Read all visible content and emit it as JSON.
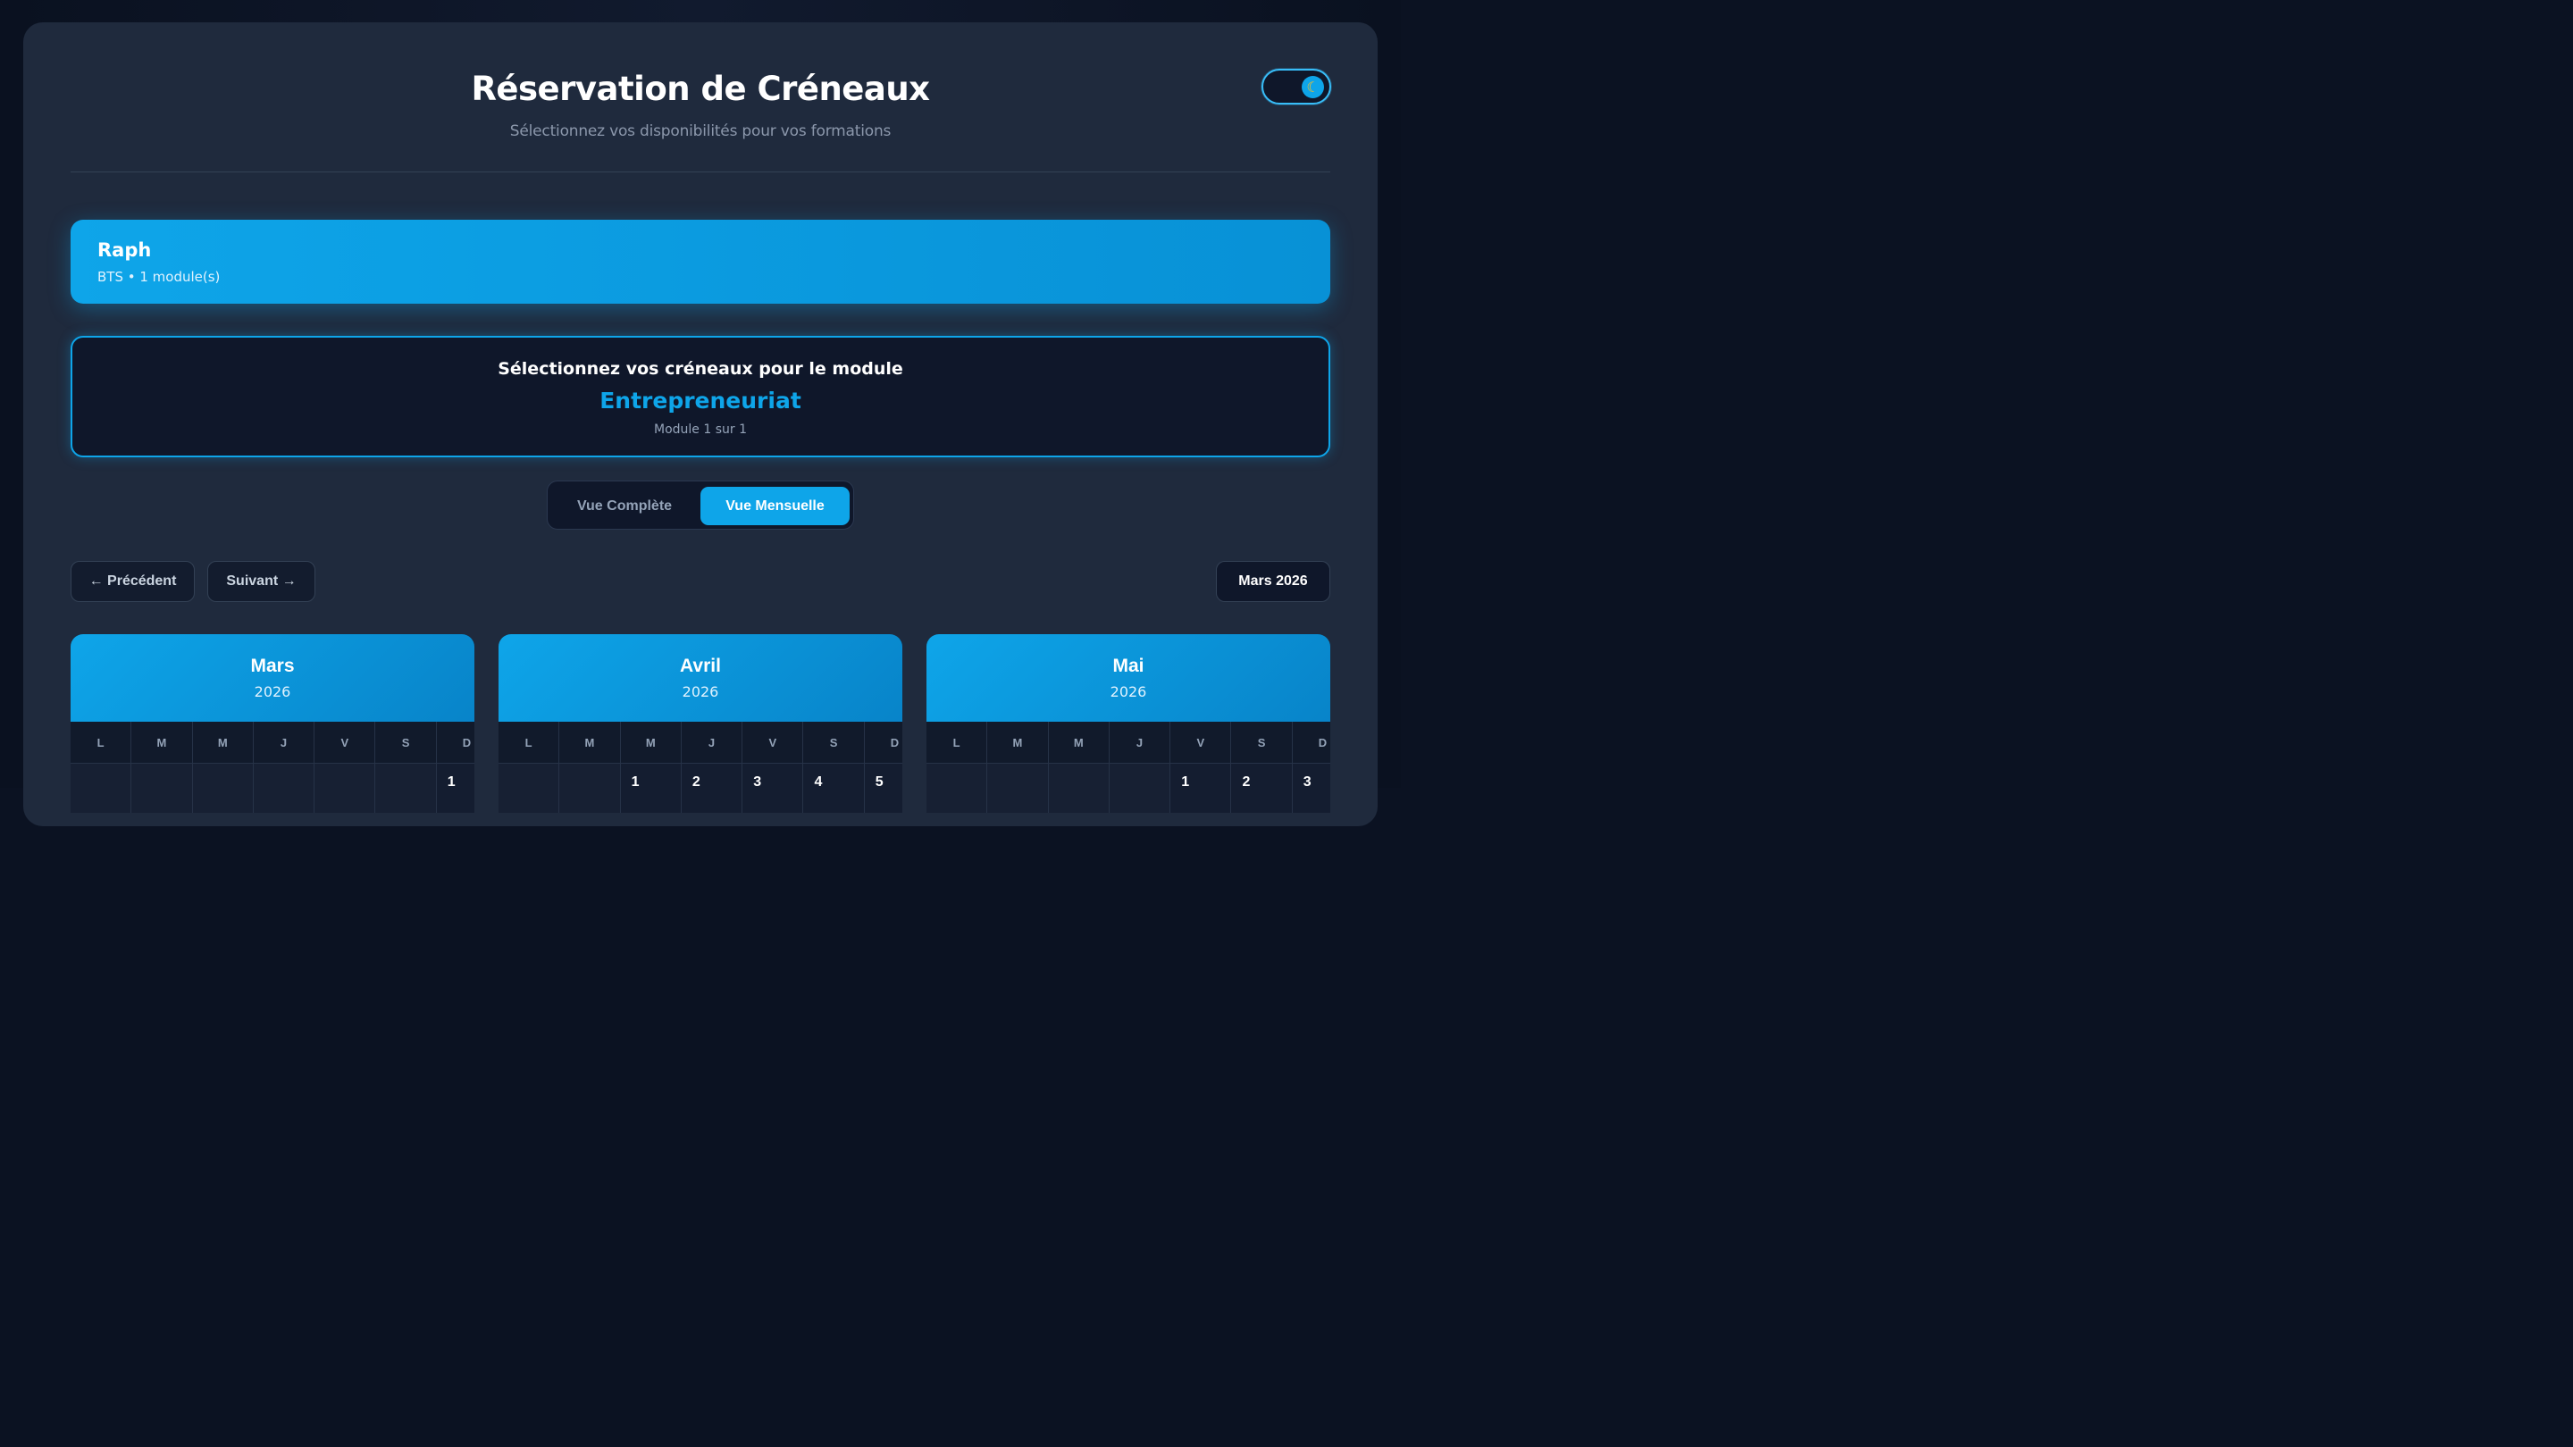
{
  "header": {
    "title": "Réservation de Créneaux",
    "subtitle": "Sélectionnez vos disponibilités pour vos formations",
    "theme_icon": "moon-icon"
  },
  "user": {
    "name": "Raph",
    "meta": "BTS • 1 module(s)"
  },
  "module": {
    "heading": "Sélectionnez vos créneaux pour le module",
    "name": "Entrepreneuriat",
    "progress": "Module 1 sur 1"
  },
  "view_switch": {
    "full_label": "Vue Complète",
    "monthly_label": "Vue Mensuelle",
    "selected": "Vue Mensuelle"
  },
  "nav": {
    "prev_label": "← Précédent",
    "next_label": "Suivant →",
    "current": "Mars 2026"
  },
  "weekdays": [
    "L",
    "M",
    "M",
    "J",
    "V",
    "S",
    "D"
  ],
  "months": [
    {
      "name": "Mars",
      "year": "2026",
      "first_row": [
        "",
        "",
        "",
        "",
        "",
        "",
        "1"
      ]
    },
    {
      "name": "Avril",
      "year": "2026",
      "first_row": [
        "",
        "",
        "1",
        "2",
        "3",
        "4",
        "5"
      ]
    },
    {
      "name": "Mai",
      "year": "2026",
      "first_row": [
        "",
        "",
        "",
        "",
        "1",
        "2",
        "3"
      ]
    }
  ],
  "colors": {
    "accent": "#0ea5e9",
    "panel": "#1f2a3d",
    "background": "#0b1222"
  }
}
